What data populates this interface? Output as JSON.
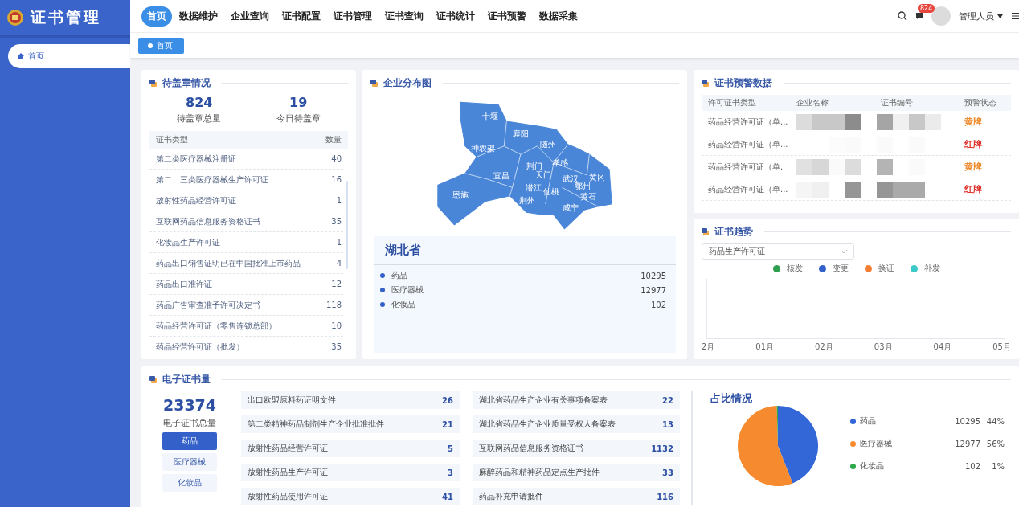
{
  "app_title": "证书管理",
  "nav": [
    {
      "label": "首页",
      "selected": true
    },
    {
      "label": "数据维护",
      "selected": false
    },
    {
      "label": "企业查询",
      "selected": false
    },
    {
      "label": "证书配置",
      "selected": false
    },
    {
      "label": "证书管理",
      "selected": false
    },
    {
      "label": "证书查询",
      "selected": false
    },
    {
      "label": "证书统计",
      "selected": false
    },
    {
      "label": "证书预警",
      "selected": false
    },
    {
      "label": "数据采集",
      "selected": false
    }
  ],
  "header": {
    "badge": "824",
    "user": "管理人员"
  },
  "sidebar": {
    "items": [
      {
        "label": "首页",
        "selected": true
      }
    ]
  },
  "open_tabs": [
    {
      "label": "首页",
      "selected": true
    }
  ],
  "pending": {
    "title": "待盖章情况",
    "stats": [
      {
        "value": "824",
        "label": "待盖章总量"
      },
      {
        "value": "19",
        "label": "今日待盖章"
      }
    ],
    "columns": [
      "证书类型",
      "数量"
    ],
    "rows": [
      {
        "name": "第二类医疗器械注册证",
        "count": "40"
      },
      {
        "name": "第二、三类医疗器械生产许可证",
        "count": "16"
      },
      {
        "name": "放射性药品经营许可证",
        "count": "1"
      },
      {
        "name": "互联网药品信息服务资格证书",
        "count": "35"
      },
      {
        "name": "化妆品生产许可证",
        "count": "1"
      },
      {
        "name": "药品出口销售证明已在中国批准上市药品",
        "count": "4"
      },
      {
        "name": "药品出口准许证",
        "count": "12"
      },
      {
        "name": "药品广告审查准予许可决定书",
        "count": "118"
      },
      {
        "name": "药品经营许可证（零售连锁总部）",
        "count": "10"
      },
      {
        "name": "药品经营许可证（批发）",
        "count": "35"
      }
    ]
  },
  "distribution": {
    "title": "企业分布图",
    "cities": [
      "十堰",
      "襄阳",
      "随州",
      "神农架",
      "荆门",
      "孝感",
      "宜昌",
      "天门",
      "武汉",
      "黄冈",
      "鄂州",
      "潜江",
      "仙桃",
      "恩施",
      "荆州",
      "黄石",
      "咸宁"
    ],
    "province": "湖北省",
    "items": [
      {
        "label": "药品",
        "value": "10295"
      },
      {
        "label": "医疗器械",
        "value": "12977"
      },
      {
        "label": "化妆品",
        "value": "102"
      }
    ]
  },
  "warnings": {
    "title": "证书预警数据",
    "columns": [
      "许可证书类型",
      "企业名称",
      "证书编号",
      "预警状态"
    ],
    "rows": [
      {
        "type": "药品经营许可证（单...",
        "status": "黄牌",
        "color": "#f08c2e"
      },
      {
        "type": "药品经营许可证（单...",
        "status": "红牌",
        "color": "#e0322d"
      },
      {
        "type": "药品经营许可证（单.",
        "status": "黄牌",
        "color": "#f08c2e"
      },
      {
        "type": "药品经营许可证（单...",
        "status": "红牌",
        "color": "#e0322d"
      }
    ]
  },
  "trend": {
    "title": "证书趋势",
    "select": "药品生产许可证",
    "legend": [
      {
        "label": "核发",
        "color": "#2e9e4f"
      },
      {
        "label": "变更",
        "color": "#3461c9"
      },
      {
        "label": "换证",
        "color": "#f47e32"
      },
      {
        "label": "补发",
        "color": "#3cc9c9"
      }
    ],
    "x_labels": [
      "2月",
      "01月",
      "02月",
      "03月",
      "04月",
      "05月"
    ]
  },
  "ecert": {
    "title": "电子证书量",
    "total": "23374",
    "total_label": "电子证书总量",
    "categories": [
      {
        "label": "药品",
        "selected": true
      },
      {
        "label": "医疗器械",
        "selected": false
      },
      {
        "label": "化妆品",
        "selected": false
      }
    ],
    "items": [
      {
        "name": "出口欧盟原料药证明文件",
        "count": "26"
      },
      {
        "name": "第二类精神药品制剂生产企业批准批件",
        "count": "21"
      },
      {
        "name": "放射性药品经营许可证",
        "count": "5"
      },
      {
        "name": "放射性药品生产许可证",
        "count": "3"
      },
      {
        "name": "放射性药品使用许可证",
        "count": "41"
      },
      {
        "name": "湖北省药品生产企业有关事项备案表",
        "count": "22"
      },
      {
        "name": "湖北省药品生产企业质量受权人备案表",
        "count": "13"
      },
      {
        "name": "互联网药品信息服务资格证书",
        "count": "1132"
      },
      {
        "name": "麻醉药品和精神药品定点生产批件",
        "count": "33"
      },
      {
        "name": "药品补充申请批件",
        "count": "116"
      }
    ],
    "share_title": "占比情况",
    "legend": [
      {
        "label": "药品",
        "count": "10295",
        "pct": "44%",
        "color": "#3366d6"
      },
      {
        "label": "医疗器械",
        "count": "12977",
        "pct": "56%",
        "color": "#f58a2f"
      },
      {
        "label": "化妆品",
        "count": "102",
        "pct": "1%",
        "color": "#2ea84a"
      }
    ],
    "chart_data": {
      "type": "pie",
      "values": [
        44.04,
        55.52,
        0.44
      ]
    }
  }
}
